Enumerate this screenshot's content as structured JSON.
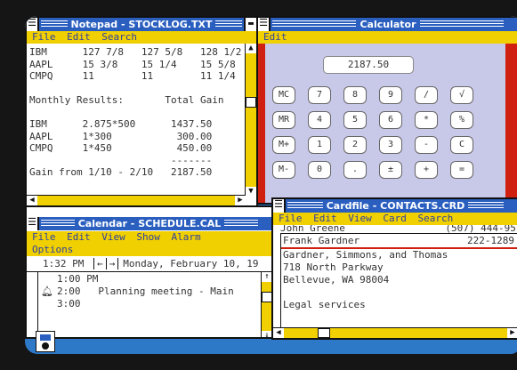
{
  "notepad": {
    "title": "Notepad - STOCKLOG.TXT",
    "menu": [
      "File",
      "Edit",
      "Search"
    ],
    "lines": [
      "IBM      127 7/8   127 5/8   128 1/2",
      "AAPL     15 3/8    15 1/4    15 5/8",
      "CMPQ     11        11        11 1/4",
      "",
      "Monthly Results:       Total Gain",
      "",
      "IBM      2.875*500      1437.50",
      "AAPL     1*300           300.00",
      "CMPQ     1*450           450.00",
      "                        -------",
      "Gain from 1/10 - 2/10   2187.50"
    ]
  },
  "calculator": {
    "title": "Calculator",
    "menu": [
      "Edit"
    ],
    "display": "2187.50",
    "keys": [
      [
        "MC",
        "7",
        "8",
        "9",
        "/",
        "√"
      ],
      [
        "MR",
        "4",
        "5",
        "6",
        "*",
        "%"
      ],
      [
        "M+",
        "1",
        "2",
        "3",
        "-",
        "C"
      ],
      [
        "M-",
        "0",
        ".",
        "±",
        "+",
        "="
      ]
    ]
  },
  "calendar": {
    "title": "Calendar - SCHEDULE.CAL",
    "menu": [
      "File",
      "Edit",
      "View",
      "Show",
      "Alarm"
    ],
    "menu2": [
      "Options"
    ],
    "time": "1:32 PM",
    "date": "Monday, February 10, 19",
    "entries": [
      {
        "time": "1:00 PM",
        "text": "",
        "alarm": false
      },
      {
        "time": "2:00",
        "text": "Planning meeting - Main",
        "alarm": true
      },
      {
        "time": "3:00",
        "text": "",
        "alarm": false
      }
    ]
  },
  "cardfile": {
    "title": "Cardfile - CONTACTS.CRD",
    "menu": [
      "File",
      "Edit",
      "View",
      "Card",
      "Search"
    ],
    "back_card": "John Greene                 (507) 444-95",
    "front_name": "Frank Gardner",
    "front_phone": "222-1289",
    "body": [
      "Gardner, Simmons, and Thomas",
      "718 North Parkway",
      "Bellevue, WA 98004",
      "",
      "Legal services"
    ]
  },
  "colors": {
    "title_bar": "#2a5fc0",
    "menu_bar": "#f0d000",
    "menu_text": "#3040a0",
    "desktop": "#2e78c8",
    "calc_border": "#d02010"
  }
}
